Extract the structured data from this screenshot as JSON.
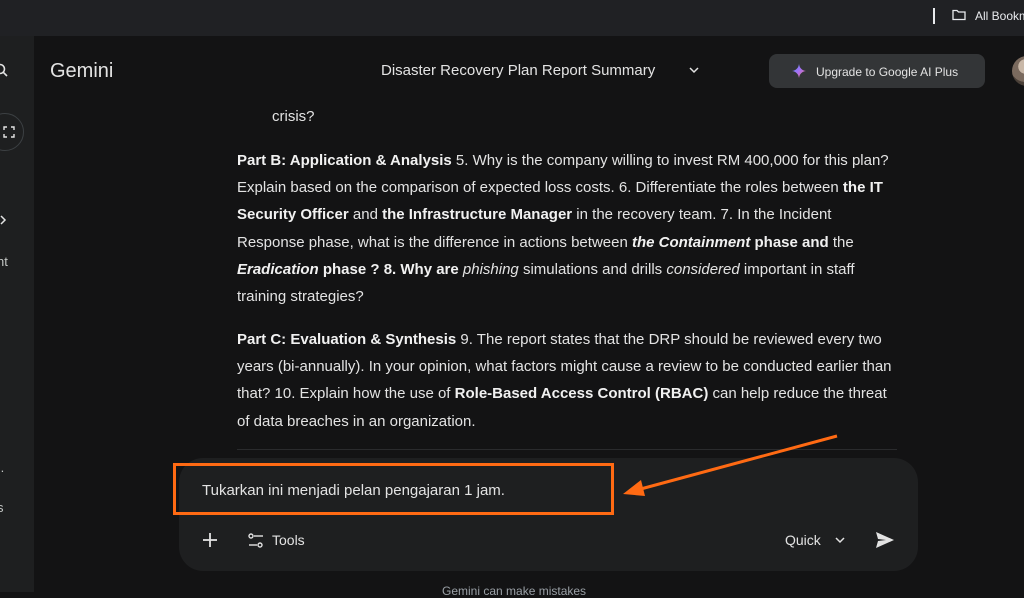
{
  "browser": {
    "bookmarks_label": "All Bookm"
  },
  "rail": {
    "fragment_1": "nt",
    "fragment_2": "..",
    "fragment_3": "s"
  },
  "header": {
    "brand": "Gemini",
    "chat_title": "Disaster Recovery Plan Report Summary",
    "upgrade_label": "Upgrade to Google AI Plus"
  },
  "response": {
    "lead_word": "crisis?",
    "part_b": {
      "heading": "Part B: Application & Analysis",
      "t1": " 5. Why is the company willing to invest RM 400,000 for this plan? Explain based on the comparison of expected loss costs. 6. Differentiate the roles between ",
      "b1": "the IT Security Officer",
      "t2": " and ",
      "b2": "the Infrastructure Manager",
      "t3": " in the recovery team. 7. In the Incident Response phase, what is the difference in actions between ",
      "bi1": "the Containment",
      "b3": " phase and",
      "t4": " the ",
      "bi2": "Eradication",
      "b4": " phase ? 8. Why are",
      "i1": " phishing",
      "t5": " simulations and drills",
      "i2": " considered",
      "t6": " important in staff training strategies?"
    },
    "part_c": {
      "heading": "Part C: Evaluation & Synthesis",
      "t1": " 9. The report states that the DRP should be reviewed every two years (bi-annually). In your opinion, what factors might cause a review to be conducted earlier than that? 10. Explain how the use of ",
      "b1": "Role-Based Access Control (RBAC)",
      "t2": " can help reduce the threat of data breaches in an organization."
    }
  },
  "prompt": {
    "text": "Tukarkan ini menjadi pelan pengajaran 1 jam.",
    "tools_label": "Tools",
    "mode_label": "Quick"
  },
  "footer": {
    "fragment": "Gemini can make mistakes"
  },
  "colors": {
    "annotation": "#ff6a13",
    "background": "#131314",
    "prompt_box": "#1e1f20"
  }
}
